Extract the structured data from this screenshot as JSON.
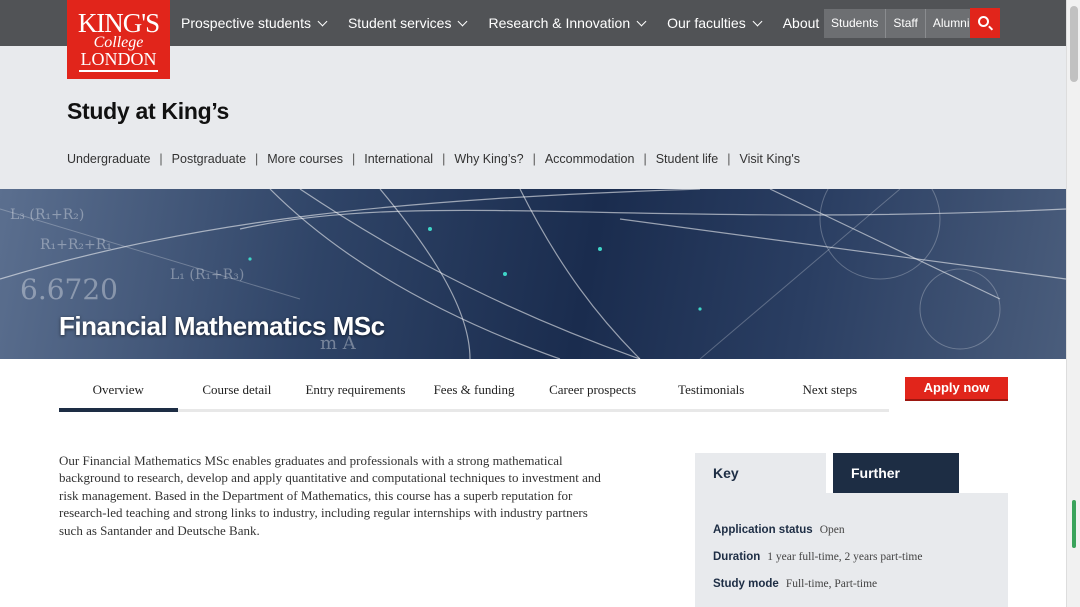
{
  "logo": {
    "line1": "KING'S",
    "line2": "College",
    "line3": "LONDON"
  },
  "nav": {
    "items": [
      "Prospective students",
      "Student services",
      "Research & Innovation",
      "Our faculties",
      "About"
    ],
    "audience": [
      "Students",
      "Staff",
      "Alumni"
    ]
  },
  "section": {
    "title": "Study at King’s",
    "links": [
      "Undergraduate",
      "Postgraduate",
      "More courses",
      "International",
      "Why King’s?",
      "Accommodation",
      "Student life",
      "Visit King's"
    ]
  },
  "hero": {
    "title": "Financial Mathematics MSc"
  },
  "course_tabs": [
    "Overview",
    "Course detail",
    "Entry requirements",
    "Fees & funding",
    "Career prospects",
    "Testimonials",
    "Next steps"
  ],
  "apply_label": "Apply now",
  "intro": "Our Financial Mathematics MSc enables graduates and professionals with a strong mathematical background to research, develop and apply quantitative and computational techniques to investment and risk management. Based in the Department of Mathematics, this course has a superb reputation for research-led teaching and strong links to industry, including regular internships with industry partners such as Santander and Deutsche Bank.",
  "sidebar": {
    "tabs": [
      "Key information",
      "Further details"
    ],
    "rows": [
      {
        "label": "Application status",
        "value": "Open"
      },
      {
        "label": "Duration",
        "value": "1 year full-time, 2 years part-time"
      },
      {
        "label": "Study mode",
        "value": "Full-time, Part-time"
      }
    ]
  },
  "colors": {
    "brand_red": "#e1251b",
    "navy": "#1d2d44",
    "topbar": "#515356"
  }
}
